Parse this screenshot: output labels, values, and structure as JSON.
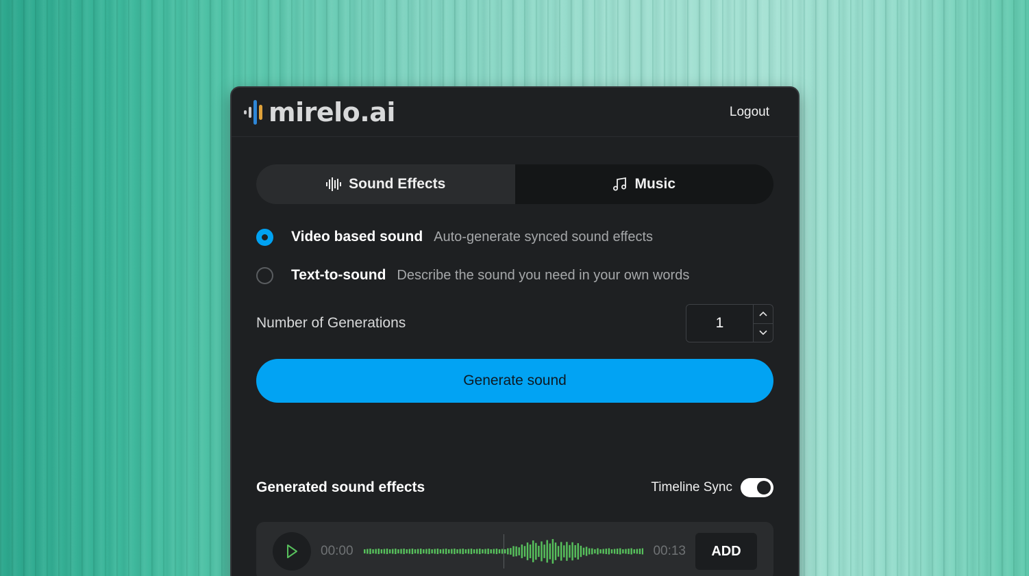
{
  "brand": {
    "name": "mirelo.ai"
  },
  "header": {
    "logout_label": "Logout"
  },
  "tabs": [
    {
      "label": "Sound Effects",
      "icon": "waveform-icon",
      "active": true
    },
    {
      "label": "Music",
      "icon": "music-note-icon",
      "active": false
    }
  ],
  "modes": [
    {
      "label": "Video based sound",
      "description": "Auto-generate synced sound effects",
      "selected": true
    },
    {
      "label": "Text-to-sound",
      "description": "Describe the sound you need in your own words",
      "selected": false
    }
  ],
  "generations": {
    "label": "Number of Generations",
    "value": "1"
  },
  "generate_button": {
    "label": "Generate sound"
  },
  "results": {
    "title": "Generated sound effects",
    "timeline_sync": {
      "label": "Timeline Sync",
      "on": true
    },
    "items": [
      {
        "current_time": "00:00",
        "duration": "00:13",
        "add_label": "ADD"
      }
    ]
  },
  "colors": {
    "accent": "#02a3f3",
    "panel": "#1e2022",
    "waveform": "#57c05c"
  }
}
